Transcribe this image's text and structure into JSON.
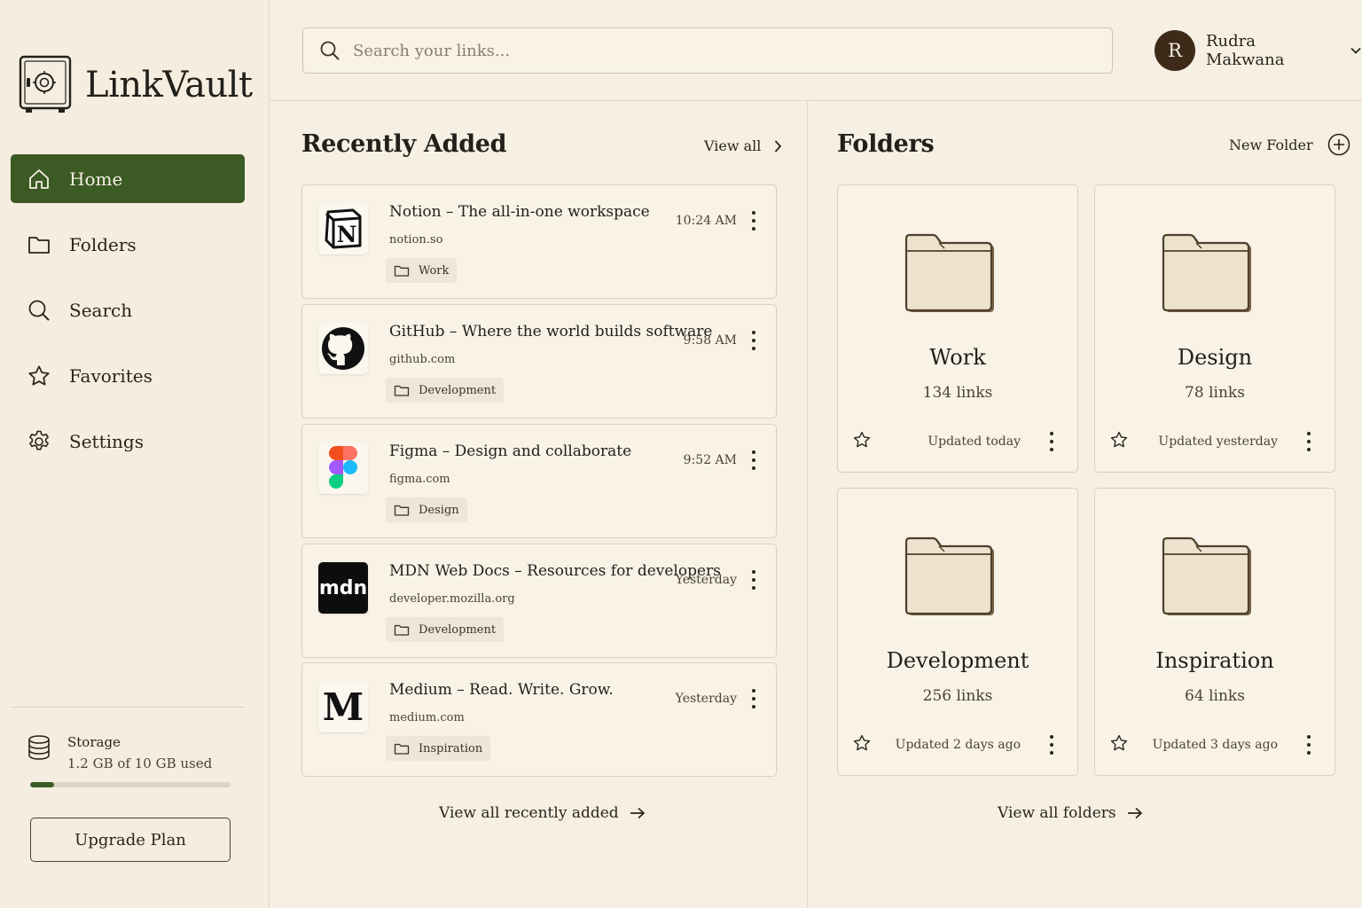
{
  "app": {
    "name": "LinkVault"
  },
  "sidebar": {
    "nav": [
      {
        "label": "Home",
        "icon": "home-icon",
        "active": true
      },
      {
        "label": "Folders",
        "icon": "folder-icon",
        "active": false
      },
      {
        "label": "Search",
        "icon": "search-icon",
        "active": false
      },
      {
        "label": "Favorites",
        "icon": "star-icon",
        "active": false
      },
      {
        "label": "Settings",
        "icon": "gear-icon",
        "active": false
      }
    ],
    "storage": {
      "label": "Storage",
      "used_text": "1.2 GB of 10 GB used",
      "fraction": 0.12
    },
    "upgrade_label": "Upgrade Plan"
  },
  "header": {
    "search_placeholder": "Search your links...",
    "user": {
      "initial": "R",
      "name": "Rudra Makwana"
    }
  },
  "recent": {
    "title": "Recently Added",
    "view_all": "View all",
    "footer": "View all recently added",
    "items": [
      {
        "title": "Notion – The all-in-one workspace",
        "domain": "notion.so",
        "folder": "Work",
        "time": "10:24 AM",
        "logo": "notion-logo"
      },
      {
        "title": "GitHub – Where the world builds software",
        "domain": "github.com",
        "folder": "Development",
        "time": "9:58 AM",
        "logo": "github-logo"
      },
      {
        "title": "Figma – Design and collaborate",
        "domain": "figma.com",
        "folder": "Design",
        "time": "9:52 AM",
        "logo": "figma-logo"
      },
      {
        "title": "MDN Web Docs – Resources for developers",
        "domain": "developer.mozilla.org",
        "folder": "Development",
        "time": "Yesterday",
        "logo": "mdn-logo",
        "logo_text": "mdn"
      },
      {
        "title": "Medium – Read. Write. Grow.",
        "domain": "medium.com",
        "folder": "Inspiration",
        "time": "Yesterday",
        "logo": "medium-logo",
        "logo_text": "M"
      }
    ]
  },
  "folders": {
    "title": "Folders",
    "new_folder": "New Folder",
    "footer": "View all folders",
    "items": [
      {
        "name": "Work",
        "count": "134 links",
        "updated": "Updated today"
      },
      {
        "name": "Design",
        "count": "78 links",
        "updated": "Updated yesterday"
      },
      {
        "name": "Development",
        "count": "256 links",
        "updated": "Updated 2 days ago"
      },
      {
        "name": "Inspiration",
        "count": "64 links",
        "updated": "Updated 3 days ago"
      }
    ]
  },
  "colors": {
    "accent": "#3b5a24",
    "background": "#f6efe3",
    "avatar": "#3d2a19",
    "border": "#ddd0bb"
  }
}
